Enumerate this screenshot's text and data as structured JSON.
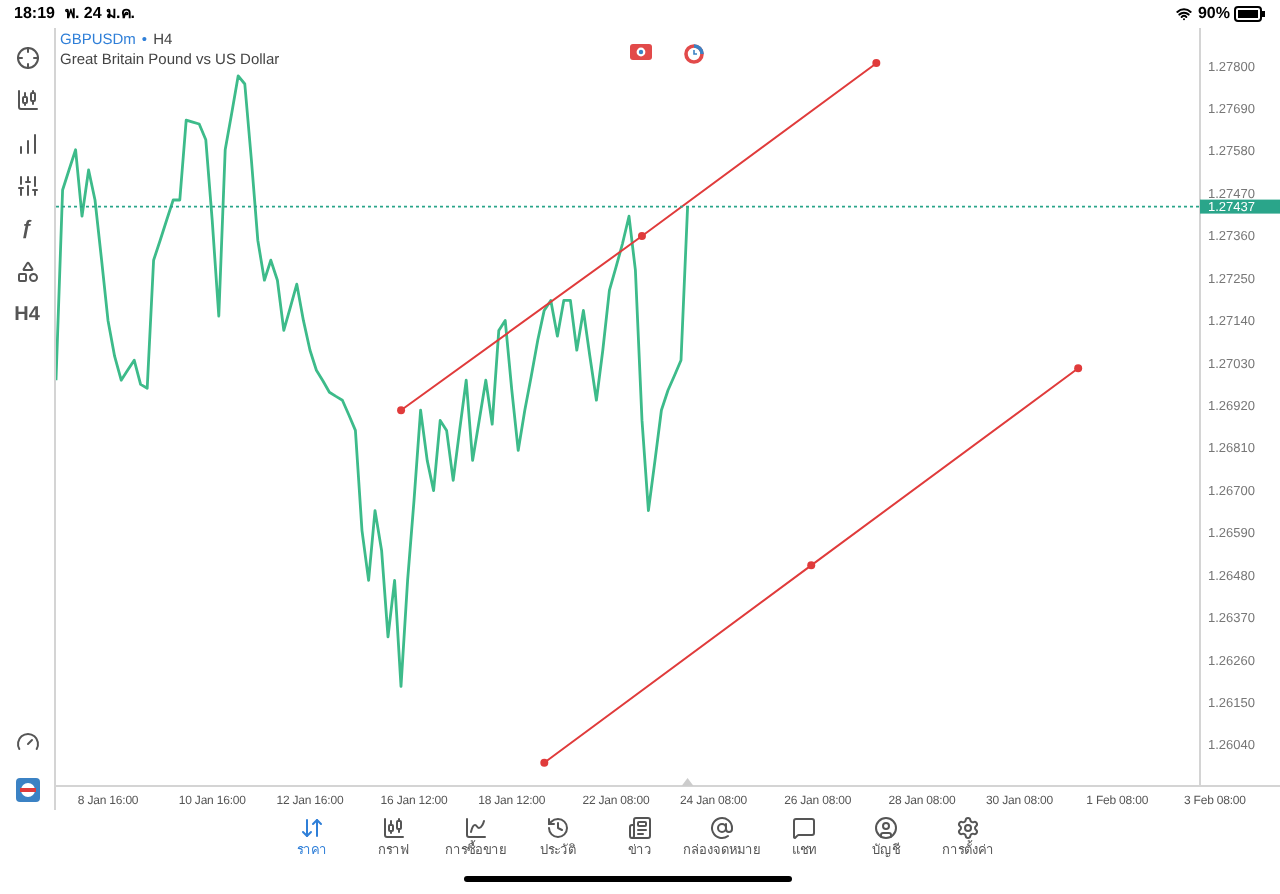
{
  "status_bar": {
    "time": "18:19",
    "date": "พ. 24 ม.ค.",
    "battery": "90%"
  },
  "left_toolbar": [
    {
      "kind": "icon"
    },
    {
      "kind": "icon"
    },
    {
      "kind": "icon"
    },
    {
      "kind": "icon"
    },
    {
      "kind": "text",
      "label": "ƒ"
    },
    {
      "kind": "icon"
    },
    {
      "kind": "text",
      "label": "H4"
    }
  ],
  "symbol": {
    "name": "GBPUSDm",
    "separator": "•",
    "timeframe": "H4",
    "description": "Great Britain Pound vs US Dollar"
  },
  "chart": {
    "chart_data": {
      "type": "line",
      "ylim": [
        1.25935,
        1.279
      ],
      "ref_lines": [
        {
          "axis": "y",
          "value": 1.27437,
          "label": "1.27437",
          "color": "#2aa58a"
        }
      ],
      "categories": [
        null,
        null,
        null,
        null,
        null,
        null,
        null,
        null,
        "8 Jan 16:00",
        null,
        null,
        null,
        null,
        null,
        null,
        null,
        null,
        null,
        null,
        null,
        null,
        null,
        null,
        null,
        "10 Jan 16:00",
        null,
        null,
        null,
        null,
        null,
        null,
        null,
        null,
        null,
        null,
        null,
        null,
        null,
        null,
        "12 Jan 16:00",
        null,
        null,
        null,
        null,
        null,
        null,
        null,
        null,
        null,
        null,
        null,
        null,
        null,
        null,
        null,
        "16 Jan 12:00",
        null,
        null,
        null,
        null,
        null,
        null,
        null,
        null,
        null,
        null,
        null,
        null,
        null,
        null,
        "18 Jan 12:00",
        null,
        null,
        null,
        null,
        null,
        null,
        null,
        null,
        null,
        null,
        null,
        null,
        null,
        null,
        null,
        "22 Jan 08:00",
        null,
        null,
        null,
        null,
        null,
        null,
        null,
        null,
        null,
        null,
        null,
        null,
        null,
        null,
        "24 Jan 08:00",
        null,
        null,
        null,
        null,
        null,
        null,
        null,
        null,
        null,
        null,
        null,
        null,
        null,
        null,
        null,
        "26 Jan 08:00",
        null,
        null,
        null,
        null,
        null,
        null,
        null,
        null,
        null,
        null,
        null,
        null,
        null,
        null,
        null,
        "28 Jan 08:00",
        null,
        null,
        null,
        null,
        null,
        null,
        null,
        null,
        null,
        null,
        null,
        null,
        null,
        null,
        "30 Jan 08:00",
        null,
        null,
        null,
        null,
        null,
        null,
        null,
        null,
        null,
        null,
        null,
        null,
        null,
        null,
        "1 Feb 08:00",
        null,
        null,
        null,
        null,
        null,
        null,
        null,
        null,
        null,
        null,
        null,
        null,
        null,
        null,
        "3 Feb 08:00",
        null,
        null,
        null,
        null,
        null,
        null,
        null,
        null,
        null
      ],
      "series": [
        {
          "color": "#3dbb8a",
          "values": [
            1.26987,
            1.2748,
            1.27532,
            1.27584,
            1.27412,
            1.27532,
            1.27454,
            1.27298,
            1.27142,
            1.27049,
            1.26987,
            1.27013,
            1.27039,
            1.26976,
            1.26966,
            1.27298,
            1.2735,
            1.27402,
            1.27454,
            1.27454,
            1.27661,
            1.27656,
            1.27651,
            1.2761,
            1.27402,
            1.27153,
            1.27584,
            1.2768,
            1.27776,
            1.27755,
            1.27558,
            1.2735,
            1.27246,
            1.27298,
            1.27246,
            1.27116,
            1.27176,
            1.27236,
            1.27142,
            1.27065,
            1.27013,
            1.26985,
            1.26956,
            1.26945,
            1.26935,
            1.26896,
            1.26857,
            1.26597,
            1.26468,
            1.26649,
            1.26546,
            1.26322,
            1.26468,
            1.26193,
            1.26468,
            1.26675,
            1.26909,
            1.26779,
            1.26701,
            1.26883,
            1.26857,
            1.26727,
            1.26857,
            1.26987,
            1.26779,
            1.26883,
            1.26987,
            1.26873,
            1.27116,
            1.27142,
            1.26961,
            1.26805,
            1.26909,
            1.26997,
            1.27091,
            1.27168,
            1.27194,
            1.27101,
            1.27194,
            1.27194,
            1.27065,
            1.27168,
            1.2705,
            1.26935,
            1.27065,
            1.2722,
            1.2728,
            1.2734,
            1.27412,
            1.27272,
            1.26883,
            1.26649,
            1.26779,
            1.26909,
            1.26961,
            1.27,
            1.27039,
            1.27437,
            null,
            null,
            null,
            null,
            null,
            null,
            null,
            null,
            null,
            null,
            null,
            null,
            null,
            null,
            null,
            null,
            null,
            null,
            null,
            null,
            null,
            null,
            null,
            null,
            null,
            null,
            null,
            null,
            null,
            null,
            null,
            null,
            null,
            null,
            null,
            null,
            null,
            null,
            null,
            null,
            null,
            null,
            null,
            null,
            null,
            null,
            null,
            null,
            null,
            null,
            null,
            null,
            null,
            null,
            null,
            null,
            null,
            null,
            null,
            null,
            null,
            null,
            null,
            null,
            null,
            null,
            null,
            null,
            null,
            null,
            null,
            null,
            null,
            null,
            null,
            null,
            null,
            null,
            null,
            null,
            null,
            null,
            null,
            null,
            null,
            null,
            null,
            null,
            null,
            null
          ]
        },
        {
          "color": "#e03b3b",
          "marker": "circle",
          "values": [
            null,
            null,
            null,
            null,
            null,
            null,
            null,
            null,
            null,
            null,
            null,
            null,
            null,
            null,
            null,
            null,
            null,
            null,
            null,
            null,
            null,
            null,
            null,
            null,
            null,
            null,
            null,
            null,
            null,
            null,
            null,
            null,
            null,
            null,
            null,
            null,
            null,
            null,
            null,
            null,
            null,
            null,
            null,
            null,
            null,
            null,
            null,
            null,
            null,
            null,
            null,
            null,
            null,
            1.26909,
            null,
            null,
            null,
            null,
            null,
            null,
            null,
            null,
            null,
            null,
            null,
            null,
            null,
            null,
            null,
            null,
            null,
            null,
            null,
            null,
            null,
            null,
            null,
            null,
            null,
            null,
            null,
            null,
            null,
            null,
            null,
            null,
            null,
            null,
            null,
            null,
            1.27361,
            null,
            null,
            null,
            null,
            null,
            null,
            null,
            null,
            null,
            null,
            null,
            null,
            null,
            null,
            null,
            null,
            null,
            null,
            null,
            null,
            null,
            null,
            null,
            null,
            null,
            null,
            null,
            null,
            null,
            null,
            null,
            null,
            null,
            null,
            null,
            1.27809,
            null,
            null,
            null,
            null,
            null,
            null,
            null,
            null,
            null,
            null,
            null,
            null,
            null,
            null,
            null,
            null,
            null,
            null,
            null,
            null,
            null,
            null,
            null,
            null,
            null,
            null,
            null,
            null,
            null,
            null,
            null,
            null,
            null,
            null,
            null,
            null,
            null,
            null,
            null,
            null,
            null,
            null,
            null,
            null,
            null,
            null,
            null,
            null,
            null,
            null,
            null,
            null,
            null,
            null,
            null,
            null,
            null,
            null,
            null,
            null,
            null
          ]
        },
        {
          "color": "#e03b3b",
          "marker": "circle",
          "values": [
            null,
            null,
            null,
            null,
            null,
            null,
            null,
            null,
            null,
            null,
            null,
            null,
            null,
            null,
            null,
            null,
            null,
            null,
            null,
            null,
            null,
            null,
            null,
            null,
            null,
            null,
            null,
            null,
            null,
            null,
            null,
            null,
            null,
            null,
            null,
            null,
            null,
            null,
            null,
            null,
            null,
            null,
            null,
            null,
            null,
            null,
            null,
            null,
            null,
            null,
            null,
            null,
            null,
            null,
            null,
            null,
            null,
            null,
            null,
            null,
            null,
            null,
            null,
            null,
            null,
            null,
            null,
            null,
            null,
            null,
            null,
            null,
            null,
            null,
            null,
            1.25995,
            null,
            null,
            null,
            null,
            null,
            null,
            null,
            null,
            null,
            null,
            null,
            null,
            null,
            null,
            null,
            null,
            null,
            null,
            null,
            null,
            null,
            null,
            null,
            null,
            null,
            null,
            null,
            null,
            null,
            null,
            null,
            null,
            null,
            null,
            null,
            null,
            null,
            null,
            null,
            null,
            1.26507,
            null,
            null,
            null,
            null,
            null,
            null,
            null,
            null,
            null,
            null,
            null,
            null,
            null,
            null,
            null,
            null,
            null,
            null,
            null,
            null,
            null,
            null,
            null,
            null,
            null,
            null,
            null,
            null,
            null,
            null,
            null,
            null,
            null,
            null,
            null,
            null,
            null,
            null,
            null,
            null,
            1.27018,
            null,
            null,
            null,
            null,
            null,
            null,
            null,
            null,
            null,
            null,
            null,
            null,
            null,
            null,
            null,
            null,
            null,
            null,
            null,
            null,
            null,
            null,
            null,
            null,
            null,
            null,
            null,
            null,
            null,
            null
          ]
        }
      ],
      "yticks": [
        {
          "value": 1.278,
          "label": "1.27800"
        },
        {
          "value": 1.2769,
          "label": "1.27690"
        },
        {
          "value": 1.2758,
          "label": "1.27580"
        },
        {
          "value": 1.2747,
          "label": "1.27470"
        },
        {
          "value": 1.2736,
          "label": "1.27360"
        },
        {
          "value": 1.2725,
          "label": "1.27250"
        },
        {
          "value": 1.2714,
          "label": "1.27140"
        },
        {
          "value": 1.2703,
          "label": "1.27030"
        },
        {
          "value": 1.2692,
          "label": "1.26920"
        },
        {
          "value": 1.2681,
          "label": "1.26810"
        },
        {
          "value": 1.267,
          "label": "1.26700"
        },
        {
          "value": 1.2659,
          "label": "1.26590"
        },
        {
          "value": 1.2648,
          "label": "1.26480"
        },
        {
          "value": 1.2637,
          "label": "1.26370"
        },
        {
          "value": 1.2626,
          "label": "1.26260"
        },
        {
          "value": 1.2615,
          "label": "1.26150"
        },
        {
          "value": 1.2604,
          "label": "1.26040"
        }
      ]
    }
  },
  "nav_tabs": [
    {
      "label": "ราคา",
      "selected": true
    },
    {
      "label": "กราฟ",
      "selected": false
    },
    {
      "label": "การซื้อขาย",
      "selected": false
    },
    {
      "label": "ประวัติ",
      "selected": false
    },
    {
      "label": "ข่าว",
      "selected": false
    },
    {
      "label": "กล่องจดหมาย",
      "selected": false
    },
    {
      "label": "แชท",
      "selected": false
    },
    {
      "label": "บัญชี",
      "selected": false
    },
    {
      "label": "การตั้งค่า",
      "selected": false
    }
  ]
}
